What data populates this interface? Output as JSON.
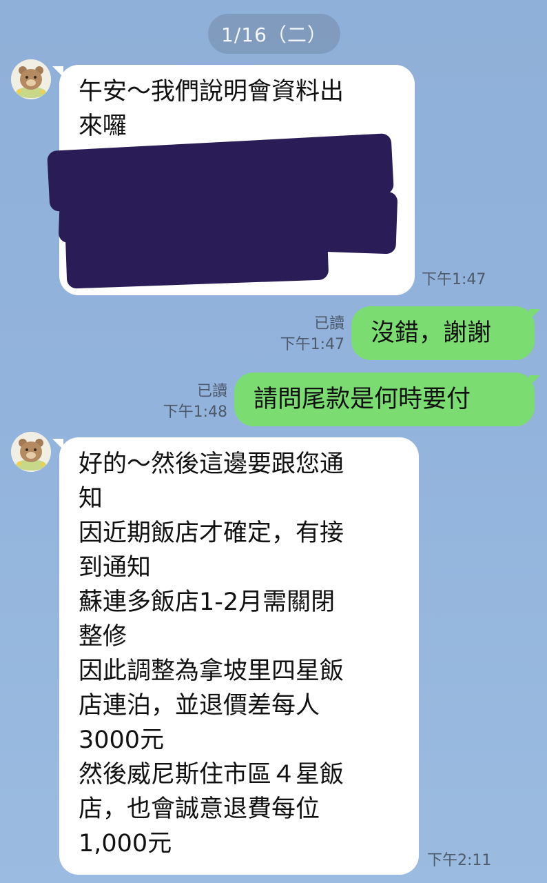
{
  "date_separator": "1/16（二）",
  "colors": {
    "outgoing_bubble": "#7bdc72",
    "incoming_bubble": "#ffffff",
    "redaction": "#2a1d57"
  },
  "messages": [
    {
      "direction": "incoming",
      "lines": [
        "午安～我們說明會資料出",
        "來囉"
      ],
      "redacted": true,
      "time": "下午1:47"
    },
    {
      "direction": "outgoing",
      "text": "沒錯，謝謝",
      "read": "已讀",
      "time": "下午1:47"
    },
    {
      "direction": "outgoing",
      "text": "請問尾款是何時要付",
      "read": "已讀",
      "time": "下午1:48"
    },
    {
      "direction": "incoming",
      "lines": [
        "好的～然後這邊要跟您通",
        "知",
        "因近期飯店才確定，有接",
        "到通知",
        "蘇連多飯店1-2月需關閉",
        "整修",
        "因此調整為拿坡里四星飯",
        "店連泊，並退價差每人",
        "3000元",
        "然後威尼斯住市區４星飯",
        "店，也會誠意退費每位",
        "1,000元"
      ],
      "time": "下午2:11"
    }
  ]
}
